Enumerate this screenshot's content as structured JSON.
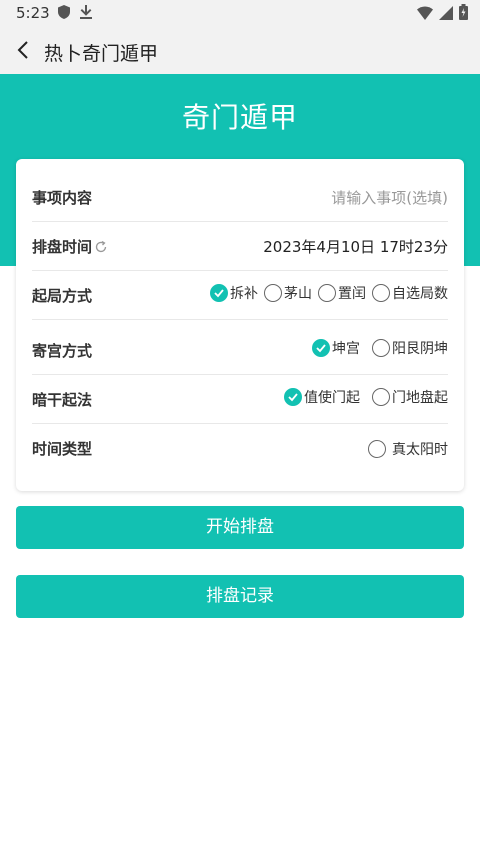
{
  "status_bar": {
    "time": "5:23",
    "icons_left": [
      "shield-icon",
      "download-icon"
    ],
    "icons_right": [
      "wifi-icon",
      "signal-icon",
      "battery-icon"
    ]
  },
  "app_bar": {
    "title": "热卜奇门遁甲",
    "back_icon": "back-arrow-icon"
  },
  "header": {
    "title": "奇门遁甲",
    "background": "#12c1b2"
  },
  "form": {
    "event": {
      "label": "事项内容",
      "placeholder": "请输入事项(选填)"
    },
    "time": {
      "label": "排盘时间",
      "value": "2023年4月10日 17时23分"
    },
    "start_method": {
      "label": "起局方式",
      "options": [
        {
          "label": "拆补",
          "checked": true
        },
        {
          "label": "茅山",
          "checked": false
        },
        {
          "label": "置闰",
          "checked": false
        },
        {
          "label": "自选局数",
          "checked": false
        }
      ]
    },
    "palace_method": {
      "label": "寄宫方式",
      "options": [
        {
          "label": "坤宫",
          "checked": true
        },
        {
          "label": "阳艮阴坤",
          "checked": false
        }
      ]
    },
    "hidden_stem": {
      "label": "暗干起法",
      "options": [
        {
          "label": "值使门起",
          "checked": true
        },
        {
          "label": "门地盘起",
          "checked": false
        }
      ]
    },
    "time_type": {
      "label": "时间类型",
      "options": [
        {
          "label": "真太阳时",
          "checked": false
        }
      ]
    }
  },
  "buttons": {
    "start": "开始排盘",
    "records": "排盘记录"
  },
  "accent_color": "#12c1b2"
}
